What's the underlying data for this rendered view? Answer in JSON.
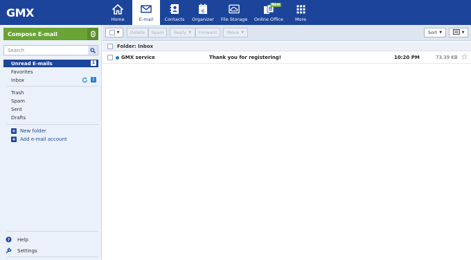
{
  "brand": {
    "logo": "GMX"
  },
  "nav": [
    {
      "label": "Home",
      "icon": "home-icon"
    },
    {
      "label": "E-mail",
      "icon": "envelope-icon",
      "active": true
    },
    {
      "label": "Contacts",
      "icon": "contacts-icon"
    },
    {
      "label": "Organizer",
      "icon": "calendar-icon",
      "icon_text": "6"
    },
    {
      "label": "File Storage",
      "icon": "cloud-icon"
    },
    {
      "label": "Online Office",
      "icon": "office-icon",
      "badge": "New"
    },
    {
      "label": "More",
      "icon": "grid-icon"
    }
  ],
  "sidebar": {
    "compose_label": "Compose E-mail",
    "search_placeholder": "Search",
    "folders": [
      {
        "label": "Unread E-mails",
        "count": "1",
        "selected": true
      },
      {
        "label": "Favorites"
      },
      {
        "label": "Inbox",
        "count": "1"
      },
      {
        "label": "Trash"
      },
      {
        "label": "Spam"
      },
      {
        "label": "Sent"
      },
      {
        "label": "Drafts"
      }
    ],
    "links": [
      {
        "label": "New folder"
      },
      {
        "label": "Add e-mail account"
      }
    ],
    "bottom": [
      {
        "label": "Help",
        "icon": "help-icon"
      },
      {
        "label": "Settings",
        "icon": "wrench-icon"
      }
    ]
  },
  "toolbar": {
    "delete": "Delete",
    "spam": "Spam",
    "reply": "Reply",
    "forward": "Forward",
    "move": "Move",
    "sort": "Sort"
  },
  "folder_header": "Folder: Inbox",
  "messages": [
    {
      "sender": "GMX service",
      "subject": "Thank you for registering!",
      "time": "10:20 PM",
      "size": "73.39 KB",
      "unread": true
    }
  ],
  "colors": {
    "brand_blue": "#1c449b",
    "compose_green": "#6aa336",
    "sidebar_bg": "#ebf1fa",
    "unread_dot": "#1c77c3"
  }
}
